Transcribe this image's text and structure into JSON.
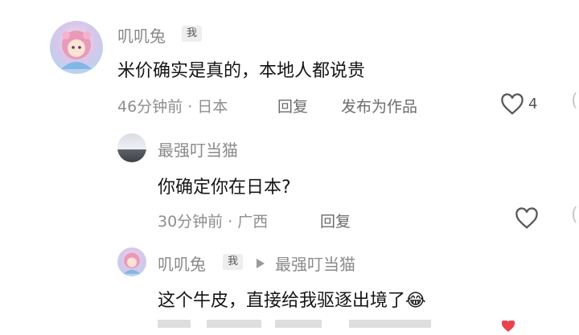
{
  "comments": [
    {
      "author": "叽叽兔",
      "badge": "我",
      "text": "米价确实是真的，本地人都说贵",
      "time_location": "46分钟前 · 日本",
      "reply_label": "回复",
      "publish_label": "发布为作品",
      "likes": "4"
    },
    {
      "author": "最强叮当猫",
      "text": "你确定你在日本?",
      "time_location": "30分钟前 · 广西",
      "reply_label": "回复"
    },
    {
      "author": "叽叽兔",
      "badge": "我",
      "reply_to": "最强叮当猫",
      "text": "这个牛皮，直接给我驱逐出境了",
      "emoji": "😂"
    }
  ],
  "colors": {
    "name": "#8a8a8a",
    "content": "#161616",
    "meta": "#8e8e8e",
    "liked": "#e8434f"
  },
  "icons": [
    "heart-outline-icon",
    "play-arrow-icon",
    "laughing-emoji-icon",
    "avatar-anime-girl",
    "avatar-landscape"
  ]
}
